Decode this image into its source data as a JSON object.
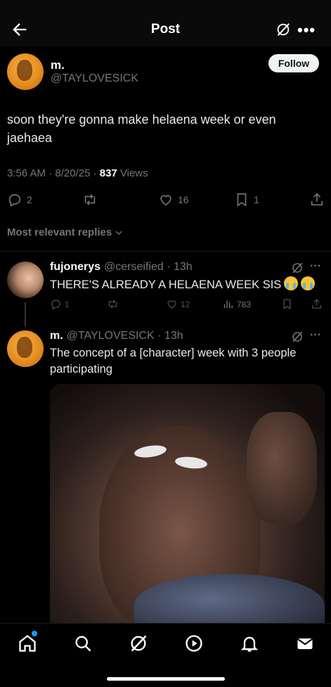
{
  "header": {
    "title": "Post",
    "back_icon": "back-arrow-icon",
    "grok_icon": "grok-icon",
    "more_label": "•••"
  },
  "post": {
    "author_name": "m.",
    "author_handle": "@TAYLOVESICK",
    "follow_label": "Follow",
    "text": "soon they're gonna make helaena week or even jaehaea",
    "time": "3:56 AM · 8/20/25 · ",
    "views_count": "837",
    "views_label": " Views",
    "replies": "2",
    "reposts": "",
    "likes": "16",
    "bookmarks": "1"
  },
  "replies_filter": "Most relevant replies",
  "replies": [
    {
      "name": "fujonerys",
      "handle": "@cerseified",
      "time": "· 13h",
      "text": "THERE'S ALREADY A HELAENA WEEK SIS",
      "reply_count": "1",
      "like_count": "12",
      "view_count": "783"
    },
    {
      "name": "m.",
      "handle": "@TAYLOVESICK",
      "time": "· 13h",
      "text": "The concept of a [character] week with 3 people participating"
    }
  ],
  "more_glyph": "···",
  "colors": {
    "background": "#000000",
    "accent": "#1d9bf0",
    "muted": "#71767b",
    "text": "#e7e9ea"
  },
  "tabbar_icons": [
    "home-icon",
    "search-icon",
    "grok-icon",
    "play-icon",
    "bell-icon",
    "mail-icon"
  ]
}
